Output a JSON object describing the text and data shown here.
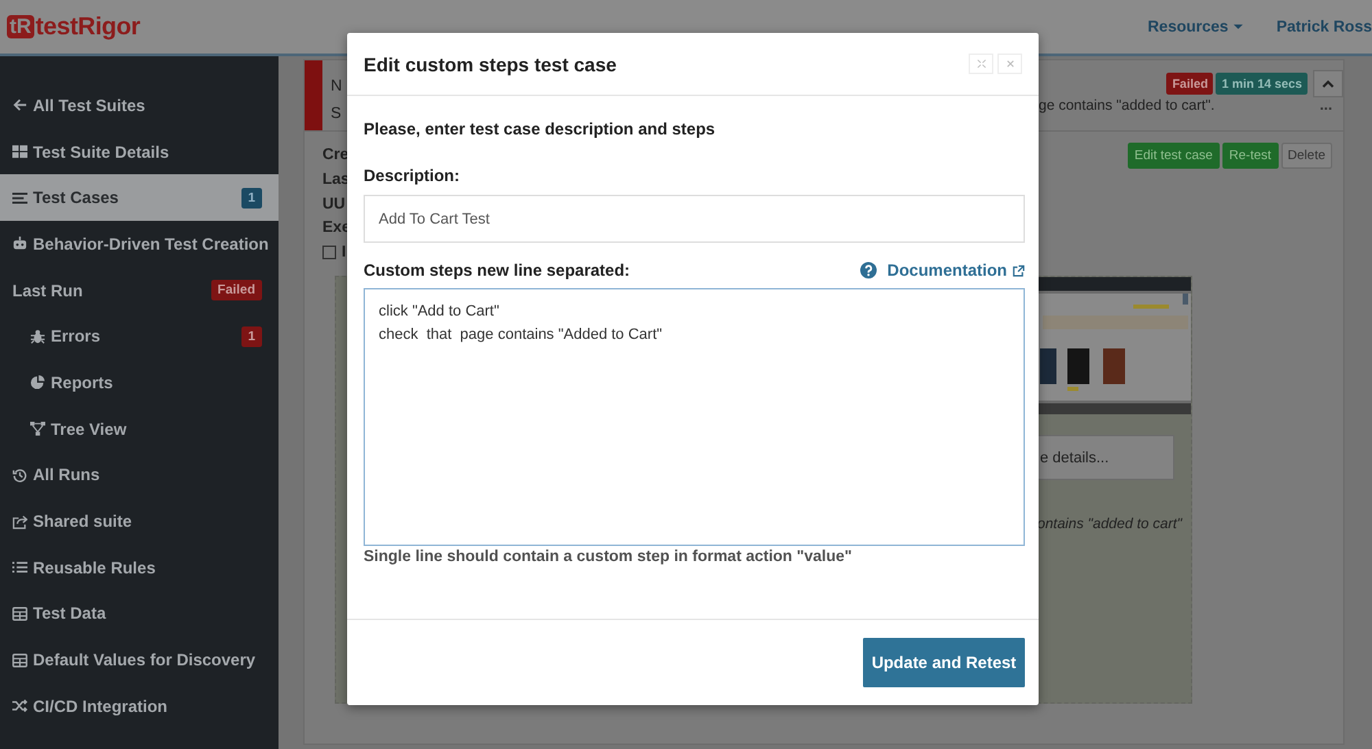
{
  "header": {
    "logo_mark": "tR",
    "logo_text": "testRigor",
    "nav": [
      {
        "label": "Resources",
        "kind": "dropdown"
      },
      {
        "label": "Patrick Ross",
        "kind": "link"
      }
    ]
  },
  "sidebar": {
    "items": [
      {
        "label": "All Test Suites",
        "selected": false
      },
      {
        "label": "Test Suite Details",
        "selected": false
      },
      {
        "label": "Test Cases",
        "selected": true,
        "badge": {
          "text": "1",
          "kind": "info"
        }
      },
      {
        "label": "Behavior-Driven Test Creation",
        "selected": false
      },
      {
        "label": "Last Run",
        "selected": false,
        "badge": {
          "text": "Failed",
          "kind": "danger"
        },
        "children": [
          {
            "label": "Errors",
            "selected": false,
            "badge": {
              "text": "1",
              "kind": "danger"
            }
          },
          {
            "label": "Reports",
            "selected": false
          },
          {
            "label": "Tree View",
            "selected": false
          }
        ]
      },
      {
        "label": "All Runs",
        "selected": false
      },
      {
        "label": "Shared suite",
        "selected": false
      },
      {
        "label": "Reusable Rules",
        "selected": false
      },
      {
        "label": "Test Data",
        "selected": false
      },
      {
        "label": "Default Values for Discovery",
        "selected": false
      },
      {
        "label": "CI/CD Integration",
        "selected": false
      }
    ]
  },
  "test_case": {
    "header_fragments": [
      "N",
      "S"
    ],
    "badges": [
      {
        "text": "Failed",
        "kind": "danger"
      },
      {
        "text": "1 min 14 secs",
        "kind": "info"
      }
    ],
    "summary_fragment": "ge contains \"added to cart\".",
    "more": "...",
    "actions": [
      {
        "label": "Edit test case",
        "kind": "primary"
      },
      {
        "label": "Re-test",
        "kind": "primary"
      },
      {
        "label": "Delete",
        "kind": "default"
      }
    ],
    "detail_fragments": [
      "Cre",
      "Las",
      "UU",
      "Exe"
    ],
    "checkbox": {
      "checked": false,
      "label_fragment": "I"
    },
    "screenshot": {
      "kind": "picture"
    },
    "details_fragment": "e details...",
    "step_fragment": "ontains \"added to cart\""
  },
  "modal": {
    "title": "Edit custom steps test case",
    "intro": "Please, enter test case description and steps",
    "description_label": "Description:",
    "description_value": "Add To Cart Test",
    "steps_label": "Custom steps new line separated:",
    "documentation_link": "Documentation",
    "steps_value": "click \"Add to Cart\"\ncheck  that  page contains \"Added to Cart\"",
    "hint": "Single line should contain a custom step in format action \"value\"",
    "submit": "Update and Retest"
  }
}
